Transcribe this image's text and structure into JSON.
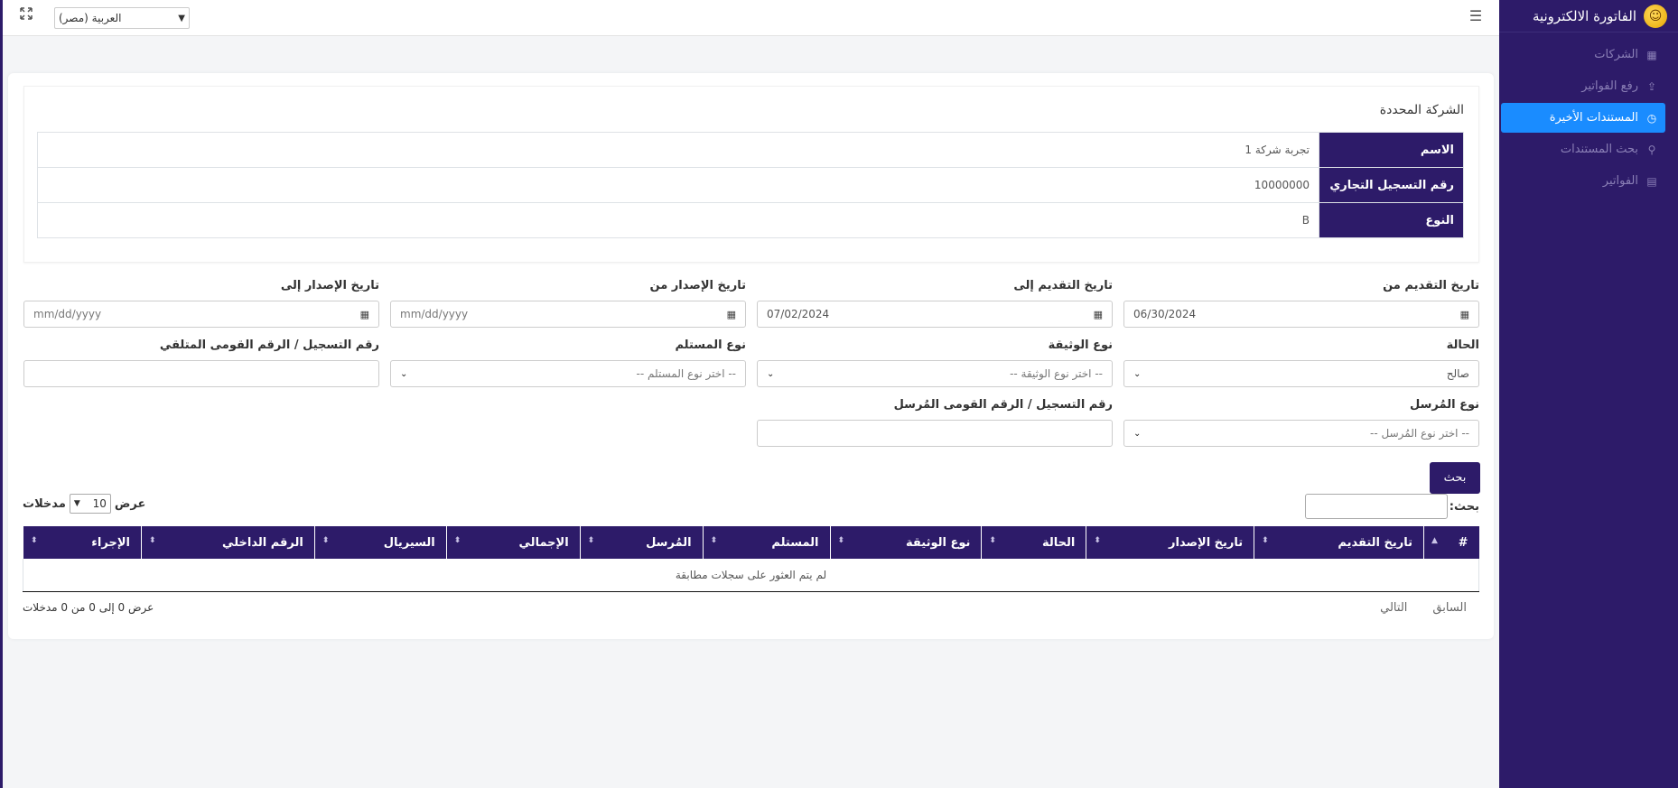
{
  "brand": {
    "title": "الفاتورة الالكترونية"
  },
  "sidebar": {
    "items": [
      {
        "label": "الشركات",
        "icon": "building-icon",
        "active": false
      },
      {
        "label": "رفع الفواتير",
        "icon": "file-upload-icon",
        "active": false
      },
      {
        "label": "المستندات الأخيرة",
        "icon": "clock-icon",
        "active": true
      },
      {
        "label": "بحث المستندات",
        "icon": "search-icon",
        "active": false
      },
      {
        "label": "الفواتير",
        "icon": "file-text-icon",
        "active": false
      }
    ]
  },
  "topbar": {
    "language": "العربية (مصر)"
  },
  "company": {
    "title": "الشركة المحددة",
    "rows": [
      {
        "label": "الاسم",
        "value": "تجربة شركة 1"
      },
      {
        "label": "رقم التسجيل التجاري",
        "value": "10000000"
      },
      {
        "label": "النوع",
        "value": "B"
      }
    ]
  },
  "filters": {
    "submit_from_label": "تاريخ التقديم من",
    "submit_from_value": "06/30/2024",
    "submit_to_label": "تاريخ التقديم إلى",
    "submit_to_value": "07/02/2024",
    "issue_from_label": "تاريخ الإصدار من",
    "issue_from_value": "mm/dd/yyyy",
    "issue_to_label": "تاريخ الإصدار إلى",
    "issue_to_value": "mm/dd/yyyy",
    "status_label": "الحالة",
    "status_value": "صالح",
    "doc_type_label": "نوع الوثيقة",
    "doc_type_placeholder": "-- اختر نوع الوثيقة --",
    "receiver_type_label": "نوع المستلم",
    "receiver_type_placeholder": "-- اختر نوع المستلم --",
    "receiver_id_label": "رقم التسجيل / الرقم القومى المتلقي",
    "sender_type_label": "نوع المُرسل",
    "sender_type_placeholder": "-- اختر نوع المُرسل --",
    "sender_id_label": "رقم التسجيل / الرقم القومى المُرسل",
    "search_button": "بحث"
  },
  "datatable": {
    "search_label": "بحث:",
    "length_show": "عرض",
    "length_value": "10",
    "length_entries": "مدخلات",
    "columns": [
      "#",
      "تاريخ التقديم",
      "تاريخ الإصدار",
      "الحالة",
      "نوع الوثيقة",
      "المستلم",
      "المُرسل",
      "الإجمالي",
      "السيريال",
      "الرقم الداخلي",
      "الإجراء"
    ],
    "empty": "لم يتم العثور على سجلات مطابقة",
    "info": "عرض 0 إلى 0 من 0 مدخلات",
    "prev": "السابق",
    "next": "التالي"
  }
}
